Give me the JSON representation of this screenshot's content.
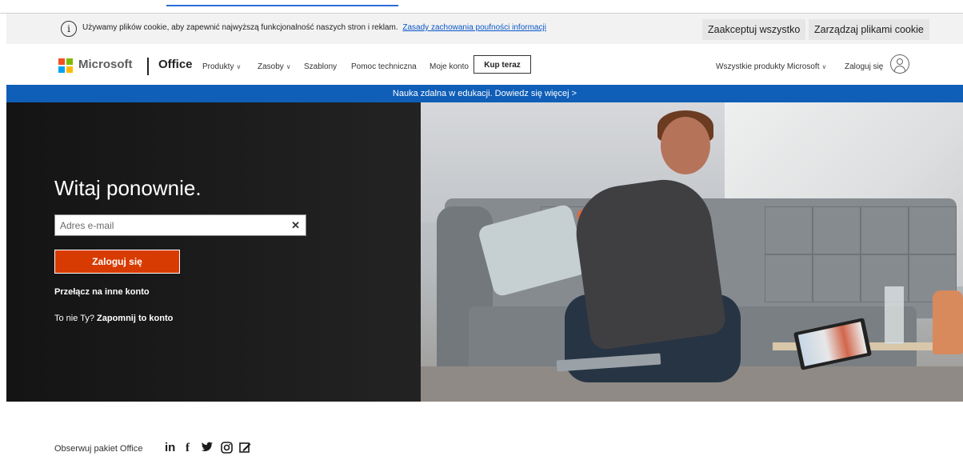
{
  "cookie_bar": {
    "message": "Używamy plików cookie, aby zapewnić najwyższą funkcjonalność naszych stron i reklam.",
    "privacy_link": "Zasady zachowania poufności informacji",
    "accept_label": "Zaakceptuj wszystko",
    "manage_label": "Zarządzaj plikami cookie"
  },
  "nav": {
    "brand": "Microsoft",
    "product": "Office",
    "items": [
      {
        "label": "Produkty",
        "dropdown": true
      },
      {
        "label": "Zasoby",
        "dropdown": true
      },
      {
        "label": "Szablony",
        "dropdown": false
      },
      {
        "label": "Pomoc techniczna",
        "dropdown": false
      },
      {
        "label": "Moje konto",
        "dropdown": false
      }
    ],
    "buy_label": "Kup teraz",
    "all_products_label": "Wszystkie produkty Microsoft",
    "signin_label": "Zaloguj się",
    "logo_colors": [
      "#f25022",
      "#7fba00",
      "#00a4ef",
      "#ffb900"
    ]
  },
  "promo": {
    "text": "Nauka zdalna w edukacji. Dowiedz się więcej >"
  },
  "hero": {
    "heading": "Witaj ponownie.",
    "email_placeholder": "Adres e-mail",
    "login_button": "Zaloguj się",
    "switch_account": "Przełącz na inne konto",
    "not_you": "To nie Ty?",
    "forget_account": "Zapomnij to konto"
  },
  "footer": {
    "follow_label": "Obserwuj pakiet Office",
    "social": [
      "linkedin-icon",
      "facebook-icon",
      "twitter-icon",
      "instagram-icon",
      "blog-icon"
    ]
  },
  "colors": {
    "accent_orange": "#d83b01",
    "promo_blue": "#0f5eb8",
    "link_blue": "#0b57c9"
  }
}
